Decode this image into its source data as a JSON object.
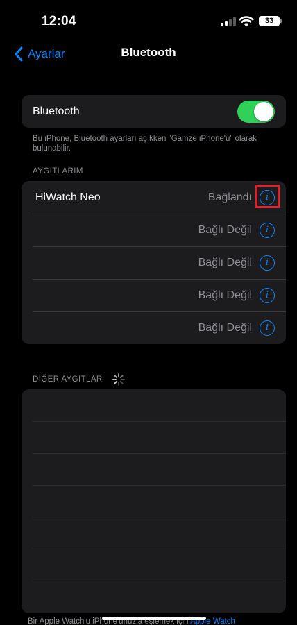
{
  "status_bar": {
    "time": "12:04",
    "battery": "33"
  },
  "nav": {
    "back_label": "Ayarlar",
    "title": "Bluetooth"
  },
  "bluetooth": {
    "label": "Bluetooth",
    "enabled": true,
    "footnote": "Bu iPhone, Bluetooth ayarları açıkken \"Gamze iPhone'u\" olarak bulunabilir."
  },
  "my_devices": {
    "header": "AYGITLARIM",
    "items": [
      {
        "name": "HiWatch Neo",
        "status": "Bağlandı"
      },
      {
        "name": "",
        "status": "Bağlı Değil"
      },
      {
        "name": "",
        "status": "Bağlı Değil"
      },
      {
        "name": "",
        "status": "Bağlı Değil"
      },
      {
        "name": "",
        "status": "Bağlı Değil"
      }
    ]
  },
  "other_devices": {
    "header": "DİĞER AYGITLAR"
  },
  "bottom_note": {
    "text": "Bir Apple Watch'u iPhone'unuzla eşlemek için ",
    "link": "Apple Watch"
  },
  "colors": {
    "accent": "#0a84ff",
    "toggle_on": "#30d158",
    "highlight": "#e0202a"
  },
  "icons": [
    "chevron-left-icon",
    "signal-icon",
    "wifi-icon",
    "battery-icon",
    "info-icon",
    "spinner-icon"
  ]
}
